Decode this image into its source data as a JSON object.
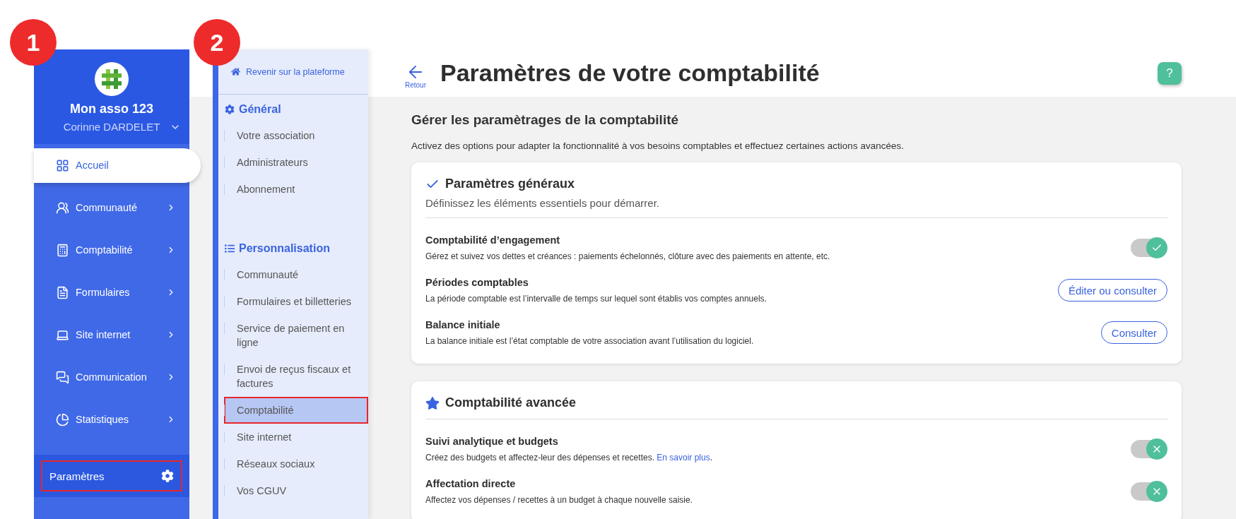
{
  "step_badges": [
    {
      "label": "1"
    },
    {
      "label": "2"
    }
  ],
  "sidebar": {
    "org_name": "Mon asso 123",
    "user_name": "Corinne DARDELET",
    "items": [
      {
        "label": "Accueil",
        "selected": true,
        "expandable": false
      },
      {
        "label": "Communauté",
        "selected": false,
        "expandable": true
      },
      {
        "label": "Comptabilité",
        "selected": false,
        "expandable": true
      },
      {
        "label": "Formulaires",
        "selected": false,
        "expandable": true
      },
      {
        "label": "Site internet",
        "selected": false,
        "expandable": true
      },
      {
        "label": "Communication",
        "selected": false,
        "expandable": true
      },
      {
        "label": "Statistiques",
        "selected": false,
        "expandable": true
      }
    ],
    "footer": {
      "label": "Paramètres",
      "outlined": true
    }
  },
  "settings_menu": {
    "back_link": "Revenir sur la plateforme",
    "sections": [
      {
        "title": "Général",
        "items": [
          {
            "label": "Votre association",
            "selected": false,
            "outlined": false
          },
          {
            "label": "Administrateurs",
            "selected": false,
            "outlined": false
          },
          {
            "label": "Abonnement",
            "selected": false,
            "outlined": false
          }
        ]
      },
      {
        "title": "Personnalisation",
        "items": [
          {
            "label": "Communauté",
            "selected": false,
            "outlined": false
          },
          {
            "label": "Formulaires et billetteries",
            "selected": false,
            "outlined": false
          },
          {
            "label": "Service de paiement en ligne",
            "selected": false,
            "outlined": false
          },
          {
            "label": "Envoi de reçus fiscaux et factures",
            "selected": false,
            "outlined": false
          },
          {
            "label": "Comptabilité",
            "selected": true,
            "outlined": true
          },
          {
            "label": "Site internet",
            "selected": false,
            "outlined": false
          },
          {
            "label": "Réseaux sociaux",
            "selected": false,
            "outlined": false
          },
          {
            "label": "Vos CGUV",
            "selected": false,
            "outlined": false
          }
        ]
      }
    ]
  },
  "header": {
    "back_label": "Retour",
    "title": "Paramètres de votre comptabilité",
    "help_label": "?"
  },
  "intro": {
    "heading": "Gérer les paramètrages de la comptabilité",
    "description": "Activez des options pour adapter la fonctionnalité à vos besoins comptables et effectuez certaines actions avancées."
  },
  "cards": [
    {
      "title": "Paramètres généraux",
      "subtitle": "Définissez les éléments essentiels pour démarrer.",
      "settings": [
        {
          "kind": "toggle",
          "title": "Comptabilité d’engagement",
          "description": "Gérez et suivez vos dettes et créances : paiements échelonnés, clôture avec des paiements en attente, etc.",
          "on": true,
          "validated": true
        },
        {
          "kind": "button",
          "title": "Périodes comptables",
          "description": "La période comptable est l’intervalle de temps sur lequel sont établis vos comptes annuels.",
          "button": "Éditer ou consulter"
        },
        {
          "kind": "button",
          "title": "Balance initiale",
          "description": "La balance initiale est l’état comptable de votre association avant l’utilisation du logiciel.",
          "button": "Consulter"
        }
      ]
    },
    {
      "title": "Comptabilité avancée",
      "settings": [
        {
          "kind": "toggle",
          "title": "Suivi analytique et budgets",
          "description": "Créez des budgets et affectez-leur des dépenses et recettes.",
          "link": "En savoir plus",
          "description_end": ".",
          "on": true,
          "validated": false
        },
        {
          "kind": "toggle",
          "title": "Affectation directe",
          "description": "Affectez vos dépenses / recettes à un budget à chaque nouvelle saisie.",
          "on": true,
          "validated": false
        }
      ]
    }
  ]
}
